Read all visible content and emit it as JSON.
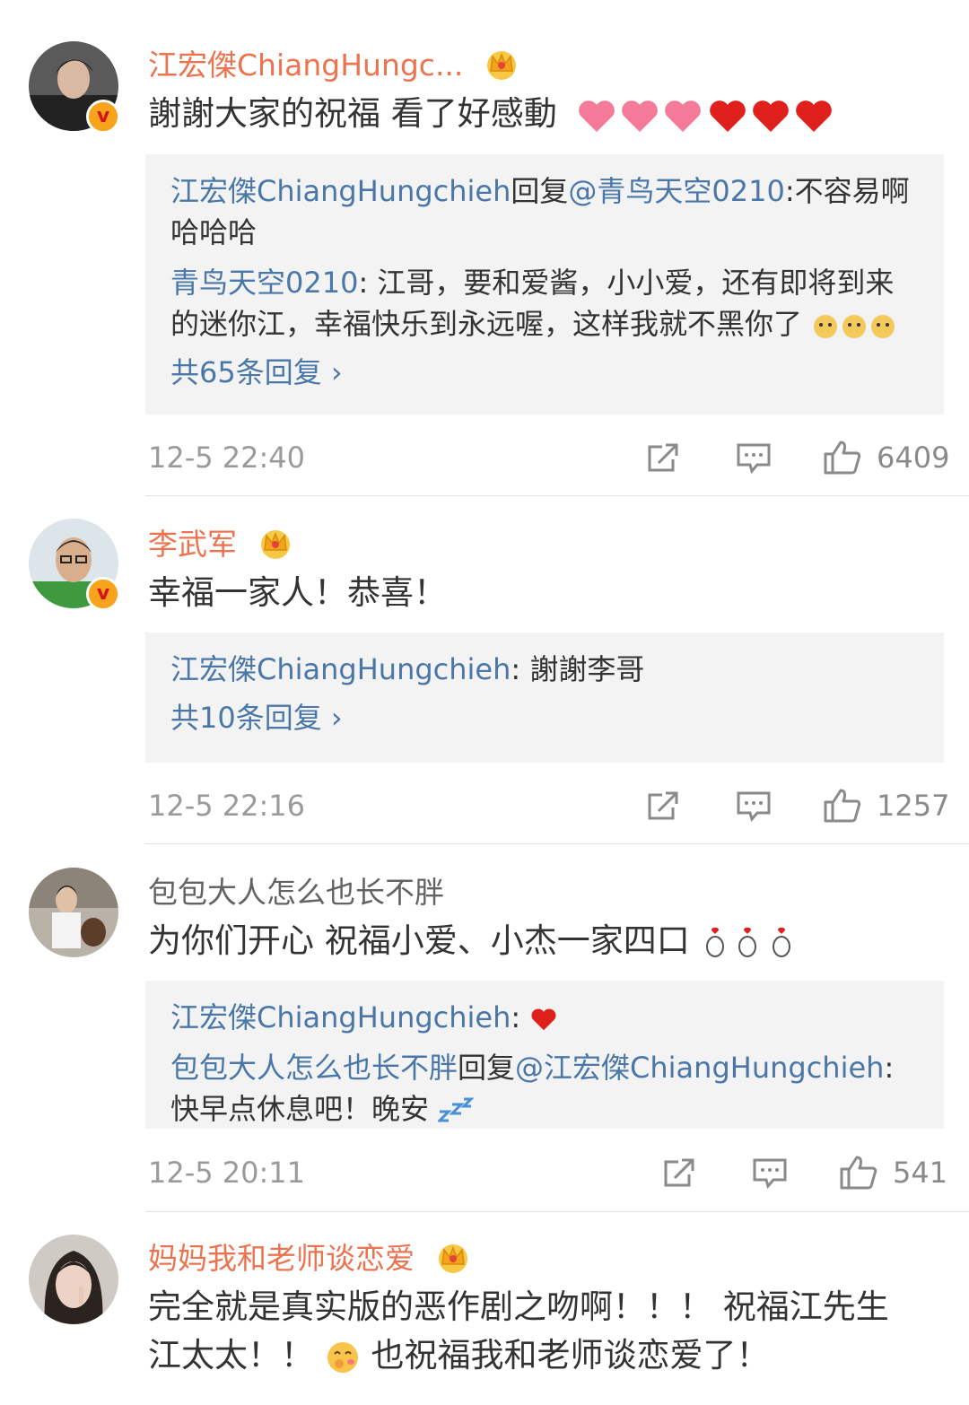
{
  "comments": [
    {
      "username": "江宏傑ChiangHungc...",
      "text": "謝謝大家的祝福  看了好感動",
      "text_emojis": [
        "pink-heart",
        "pink-heart",
        "pink-heart",
        "red-heart",
        "red-heart",
        "red-heart"
      ],
      "replies": [
        {
          "author": "江宏傑ChiangHungchieh",
          "reply_word": "回复",
          "target": "@青鸟天空0210",
          "text": ":不容易啊哈哈哈"
        },
        {
          "author": "青鸟天空0210",
          "text": ": 江哥，要和爱酱，小小爱，还有即将到来的迷你江，幸福快乐到永远喔，这样我就不黑你了"
        }
      ],
      "more": "共65条回复 ›",
      "time": "12-5 22:40",
      "likes": "6409"
    },
    {
      "username": "李武军",
      "text": "幸福一家人！恭喜！",
      "replies": [
        {
          "author": "江宏傑ChiangHungchieh",
          "text": ": 謝謝李哥"
        }
      ],
      "more": "共10条回复 ›",
      "time": "12-5 22:16",
      "likes": "1257"
    },
    {
      "username": "包包大人怎么也长不胖",
      "text": "为你们开心 祝福小爱、小杰一家四口",
      "replies": [
        {
          "author": "江宏傑ChiangHungchieh",
          "text": ": "
        },
        {
          "author": "包包大人怎么也长不胖",
          "reply_word": "回复",
          "target": "@江宏傑ChiangHungchieh",
          "text": ":快早点休息吧！晚安"
        }
      ],
      "time": "12-5 20:11",
      "likes": "541"
    },
    {
      "username": "妈妈我和老师谈恋爱",
      "text_line1": "完全就是真实版的恶作剧之吻啊！！！ 祝福江先生",
      "text_line2a": "江太太！！",
      "text_line2b": "也祝福我和老师谈恋爱了！"
    }
  ],
  "colors": {
    "vip_name": "#eb7350",
    "link": "#4a77a8",
    "reply_bg": "#f3f3f3",
    "meta": "#9a9a9a"
  }
}
